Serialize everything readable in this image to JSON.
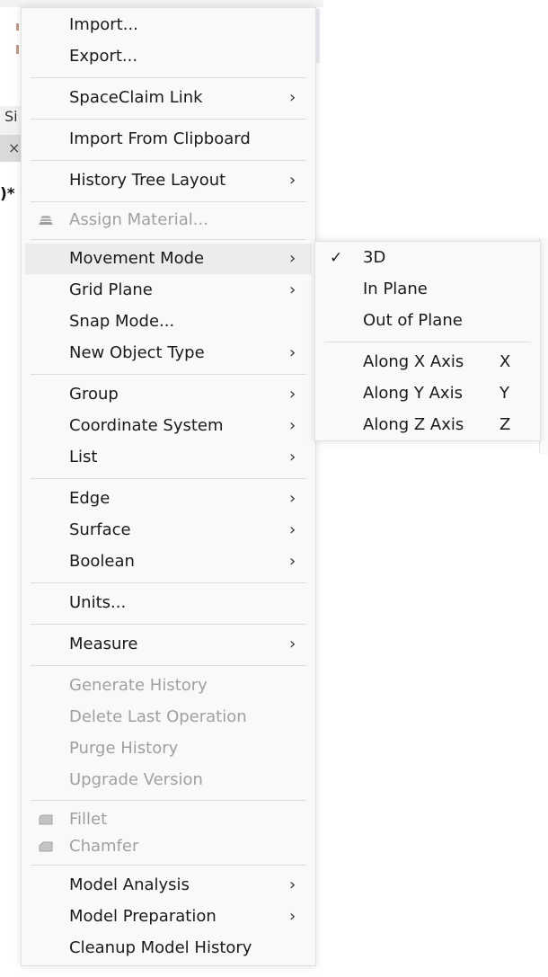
{
  "background": {
    "left_label": "Si",
    "close_glyph": "×",
    "title_fragment": ")*"
  },
  "menu": {
    "items": [
      {
        "label": "Import...",
        "submenu": false,
        "disabled": false
      },
      {
        "label": "Export...",
        "submenu": false,
        "disabled": false
      },
      {
        "label": "SpaceClaim Link",
        "submenu": true,
        "disabled": false
      },
      {
        "label": "Import From Clipboard",
        "submenu": false,
        "disabled": false
      },
      {
        "label": "History Tree Layout",
        "submenu": true,
        "disabled": false
      },
      {
        "label": "Assign Material...",
        "submenu": false,
        "disabled": true,
        "icon": "material-icon"
      },
      {
        "label": "Movement Mode",
        "submenu": true,
        "disabled": false,
        "highlighted": true
      },
      {
        "label": "Grid Plane",
        "submenu": true,
        "disabled": false
      },
      {
        "label": "Snap Mode...",
        "submenu": false,
        "disabled": false
      },
      {
        "label": "New Object Type",
        "submenu": true,
        "disabled": false
      },
      {
        "label": "Group",
        "submenu": true,
        "disabled": false
      },
      {
        "label": "Coordinate System",
        "submenu": true,
        "disabled": false
      },
      {
        "label": "List",
        "submenu": true,
        "disabled": false
      },
      {
        "label": "Edge",
        "submenu": true,
        "disabled": false
      },
      {
        "label": "Surface",
        "submenu": true,
        "disabled": false
      },
      {
        "label": "Boolean",
        "submenu": true,
        "disabled": false
      },
      {
        "label": "Units...",
        "submenu": false,
        "disabled": false
      },
      {
        "label": "Measure",
        "submenu": true,
        "disabled": false
      },
      {
        "label": "Generate History",
        "submenu": false,
        "disabled": true
      },
      {
        "label": "Delete Last Operation",
        "submenu": false,
        "disabled": true
      },
      {
        "label": "Purge History",
        "submenu": false,
        "disabled": true
      },
      {
        "label": "Upgrade Version",
        "submenu": false,
        "disabled": true
      },
      {
        "label": "Fillet",
        "submenu": false,
        "disabled": true,
        "icon": "fillet-icon"
      },
      {
        "label": "Chamfer",
        "submenu": false,
        "disabled": true,
        "icon": "chamfer-icon"
      },
      {
        "label": "Model Analysis",
        "submenu": true,
        "disabled": false
      },
      {
        "label": "Model Preparation",
        "submenu": true,
        "disabled": false
      },
      {
        "label": "Cleanup Model History",
        "submenu": false,
        "disabled": false
      }
    ],
    "chevron_glyph": "›"
  },
  "submenu": {
    "parent": "Movement Mode",
    "check_glyph": "✓",
    "items": [
      {
        "label": "3D",
        "checked": true,
        "shortcut": ""
      },
      {
        "label": "In Plane",
        "checked": false,
        "shortcut": ""
      },
      {
        "label": "Out of Plane",
        "checked": false,
        "shortcut": ""
      },
      {
        "label": "Along X Axis",
        "checked": false,
        "shortcut": "X"
      },
      {
        "label": "Along Y Axis",
        "checked": false,
        "shortcut": "Y"
      },
      {
        "label": "Along Z Axis",
        "checked": false,
        "shortcut": "Z"
      }
    ]
  }
}
